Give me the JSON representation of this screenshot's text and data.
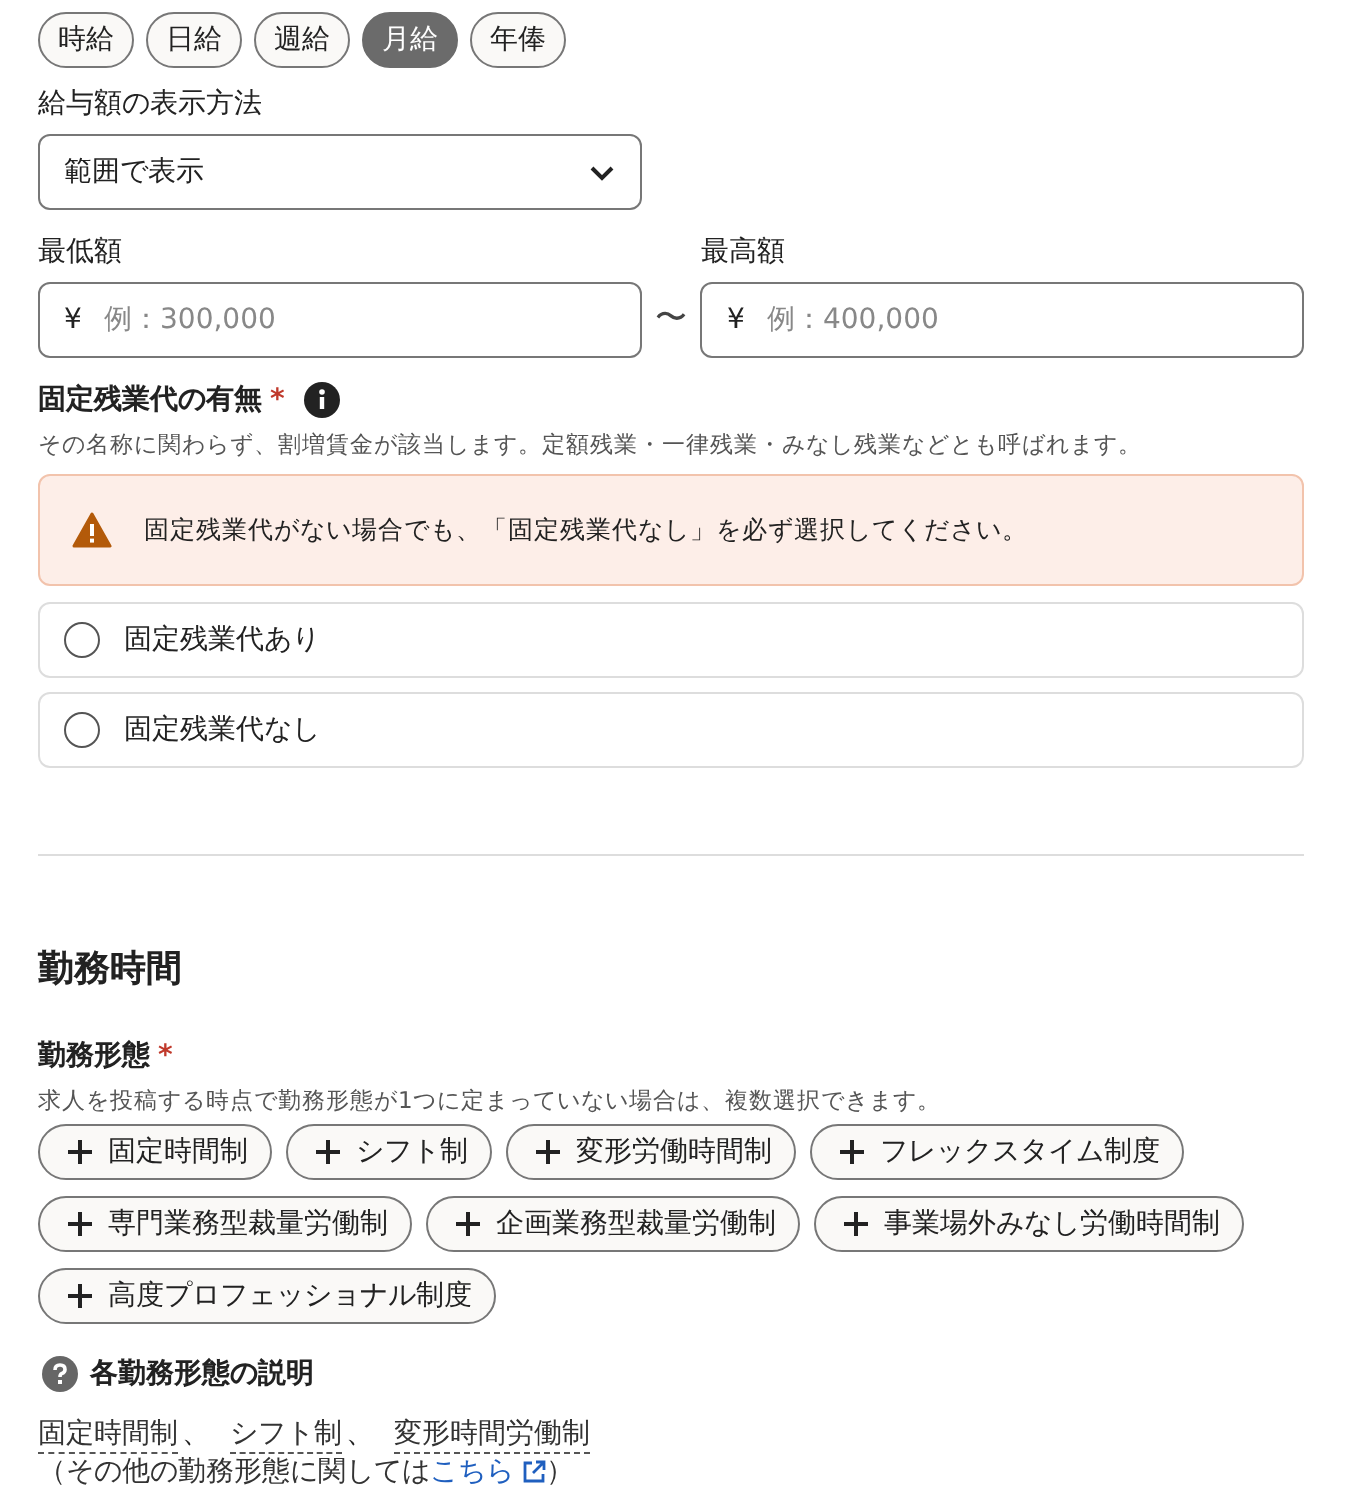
{
  "pay_period_tabs": [
    {
      "label": "時給",
      "selected": false
    },
    {
      "label": "日給",
      "selected": false
    },
    {
      "label": "週給",
      "selected": false
    },
    {
      "label": "月給",
      "selected": true
    },
    {
      "label": "年俸",
      "selected": false
    }
  ],
  "display_method": {
    "label": "給与額の表示方法",
    "value": "範囲で表示"
  },
  "min_amount": {
    "label": "最低額",
    "prefix": "¥",
    "placeholder": "例：300,000"
  },
  "range_separator": "〜",
  "max_amount": {
    "label": "最高額",
    "prefix": "¥",
    "placeholder": "例：400,000"
  },
  "fixed_overtime": {
    "label": "固定残業代の有無",
    "required_mark": "*",
    "description": "その名称に関わらず、割増賃金が該当します。定額残業・一律残業・みなし残業などとも呼ばれます。",
    "alert": "固定残業代がない場合でも、「固定残業代なし」を必ず選択してください。",
    "options": [
      {
        "label": "固定残業代あり",
        "selected": false
      },
      {
        "label": "固定残業代なし",
        "selected": false
      }
    ]
  },
  "work_hours": {
    "heading": "勤務時間",
    "work_style": {
      "label": "勤務形態",
      "required_mark": "*",
      "description": "求人を投稿する時点で勤務形態が1つに定まっていない場合は、複数選択できます。",
      "options": [
        {
          "label": "固定時間制",
          "selected": false
        },
        {
          "label": "シフト制",
          "selected": false
        },
        {
          "label": "変形労働時間制",
          "selected": false
        },
        {
          "label": "フレックスタイム制度",
          "selected": false
        },
        {
          "label": "専門業務型裁量労働制",
          "selected": false
        },
        {
          "label": "企画業務型裁量労働制",
          "selected": false
        },
        {
          "label": "事業場外みなし労働時間制",
          "selected": false
        },
        {
          "label": "高度プロフェッショナル制度",
          "selected": false
        }
      ]
    },
    "explanation": {
      "title": "各勤務形態の説明",
      "links": [
        {
          "label": "固定時間制",
          "separator": "、"
        },
        {
          "label": "シフト制",
          "separator": "、"
        },
        {
          "label": "変形時間労働制"
        }
      ],
      "note_before": "（その他の勤務形態に関しては",
      "note_link": "こちら",
      "note_after": "）"
    }
  }
}
